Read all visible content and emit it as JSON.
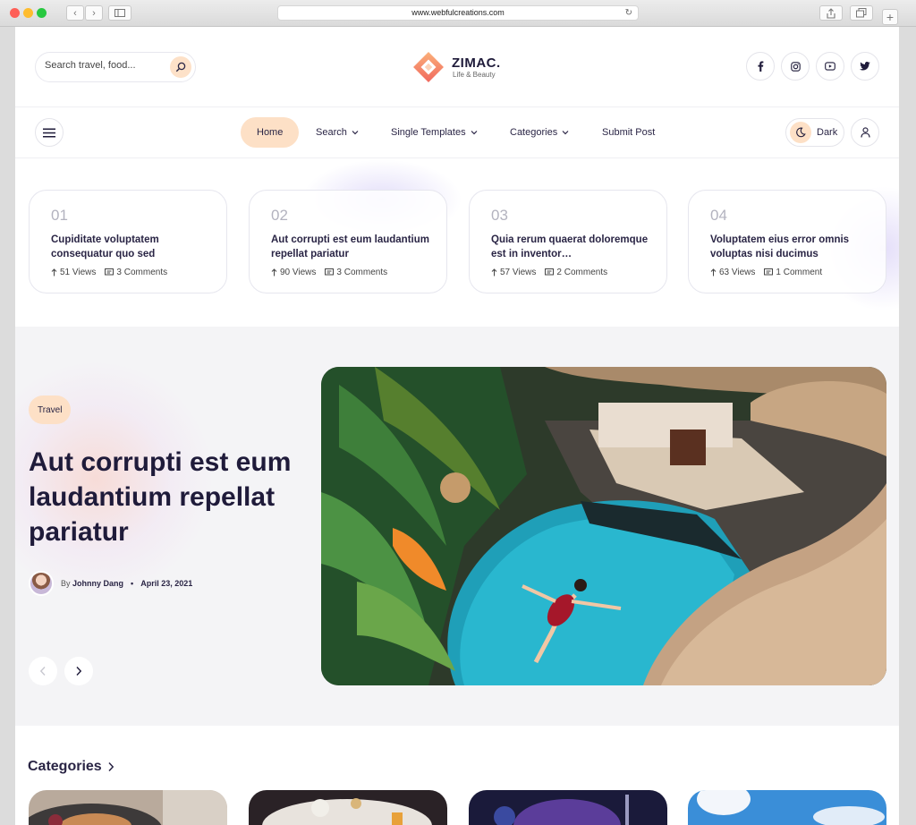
{
  "browser": {
    "url": "www.webfulcreations.com"
  },
  "header": {
    "search_placeholder": "Search travel, food...",
    "logo_name": "ZIMAC.",
    "logo_tagline": "Life & Beauty",
    "social": [
      "facebook-icon",
      "instagram-icon",
      "youtube-icon",
      "twitter-icon"
    ]
  },
  "nav": {
    "items": [
      {
        "label": "Home",
        "active": true
      },
      {
        "label": "Search",
        "dropdown": true
      },
      {
        "label": "Single Templates",
        "dropdown": true
      },
      {
        "label": "Categories",
        "dropdown": true
      },
      {
        "label": "Submit Post",
        "dropdown": false
      }
    ],
    "dark_label": "Dark"
  },
  "trending": [
    {
      "num": "01",
      "title": "Cupiditate voluptatem consequatur quo sed",
      "views": "51 Views",
      "comments": "3 Comments"
    },
    {
      "num": "02",
      "title": "Aut corrupti est eum laudantium repellat pariatur",
      "views": "90 Views",
      "comments": "3 Comments"
    },
    {
      "num": "03",
      "title": "Quia rerum quaerat doloremque est in inventor…",
      "views": "57 Views",
      "comments": "2 Comments"
    },
    {
      "num": "04",
      "title": "Voluptatem eius error omnis voluptas nisi ducimus",
      "views": "63 Views",
      "comments": "1 Comment"
    }
  ],
  "hero": {
    "category": "Travel",
    "title": "Aut corrupti est eum laudantium repellat pariatur",
    "by": "By",
    "author": "Johnny Dang",
    "date": "April 23, 2021"
  },
  "categories": {
    "title": "Categories"
  },
  "colors": {
    "accent": "#fde0c6",
    "brand_orange": "#f58a5a",
    "text_dark": "#1f1b3a",
    "hero_bg": "#f4f4f6"
  }
}
